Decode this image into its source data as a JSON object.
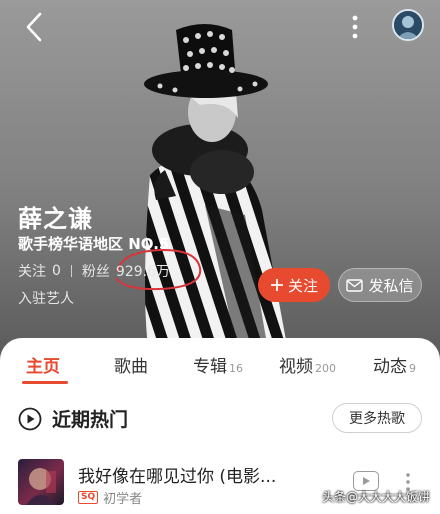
{
  "header": {
    "back_icon": "chevron-left-icon",
    "more_icon": "vertical-dots-icon",
    "avatar_icon": "user-avatar"
  },
  "artist": {
    "name": "薛之谦",
    "rank": "歌手榜华语地区 NO.5",
    "following_label": "关注",
    "following_count": "0",
    "fans_label": "粉丝",
    "fans_count": "929.6万",
    "resident": "入驻艺人"
  },
  "actions": {
    "follow_label": "关注",
    "message_label": "发私信"
  },
  "tabs": [
    {
      "label": "主页",
      "count": ""
    },
    {
      "label": "歌曲",
      "count": ""
    },
    {
      "label": "专辑",
      "count": "16"
    },
    {
      "label": "视频",
      "count": "200"
    },
    {
      "label": "动态",
      "count": "9"
    }
  ],
  "section": {
    "title": "近期热门",
    "more_label": "更多热歌"
  },
  "song": {
    "title": "我好像在哪见过你 (电影...",
    "quality_badge": "SQ",
    "album": "初学者"
  },
  "watermark": "头条@大大大大饭饼",
  "colors": {
    "accent": "#e84a2f",
    "annotation": "#d9343a"
  }
}
